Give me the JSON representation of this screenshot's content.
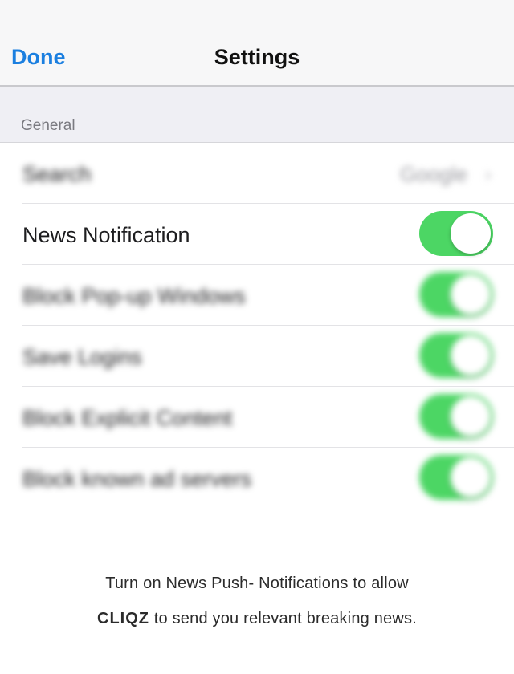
{
  "navbar": {
    "done_label": "Done",
    "title": "Settings",
    "accent_color": "#1b7fe0"
  },
  "section": {
    "header": "General"
  },
  "rows": [
    {
      "label": "Search",
      "value": "Google",
      "control": "chevron",
      "blurred": true
    },
    {
      "label": "News Notification",
      "control": "toggle",
      "on": true,
      "blurred": false
    },
    {
      "label": "Block Pop-up Windows",
      "control": "toggle",
      "on": true,
      "blurred": true
    },
    {
      "label": "Save Logins",
      "control": "toggle",
      "on": true,
      "blurred": true
    },
    {
      "label": "Block Explicit Content",
      "control": "toggle",
      "on": true,
      "blurred": true
    },
    {
      "label": "Block known ad servers",
      "control": "toggle",
      "on": true,
      "blurred": true
    }
  ],
  "toggle_on_color": "#4cd664",
  "icons": {
    "chevron": "chevron-right-icon",
    "chevron_glyph": "›"
  },
  "footer": {
    "line1": "Turn on News Push- Notifications to allow",
    "brand": "CLIQZ",
    "line2_rest": " to send you relevant breaking news."
  }
}
